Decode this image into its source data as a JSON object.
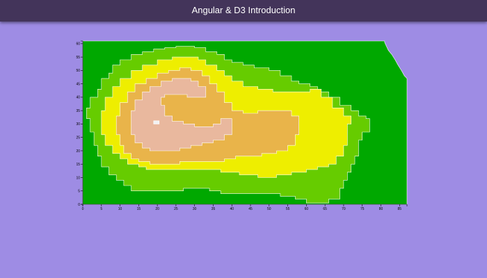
{
  "app": {
    "title": "Angular & D3 Introduction"
  },
  "colors": {
    "page_bg": "#9e8ce4",
    "header_bg": "#43345a",
    "level_colors": [
      "#00a800",
      "#66cc00",
      "#eeee00",
      "#e9b44a",
      "#e9b89e",
      "#f2f2f2"
    ],
    "contour_stroke": "#ffffff"
  },
  "chart_data": {
    "type": "heatmap",
    "title": "",
    "xlabel": "",
    "ylabel": "",
    "xlim": [
      0,
      87
    ],
    "ylim": [
      0,
      61
    ],
    "x_ticks": [
      0,
      5,
      10,
      15,
      20,
      25,
      30,
      35,
      40,
      45,
      50,
      55,
      60,
      65,
      70,
      75,
      80,
      85
    ],
    "y_ticks": [
      0,
      5,
      10,
      15,
      20,
      25,
      30,
      35,
      40,
      45,
      50,
      55,
      60
    ],
    "contour_levels": [
      {
        "level": 1,
        "color": "#66cc00",
        "polygon": [
          [
            2,
            40
          ],
          [
            4,
            43
          ],
          [
            5,
            47
          ],
          [
            7,
            49
          ],
          [
            8,
            52
          ],
          [
            10,
            54
          ],
          [
            13,
            56
          ],
          [
            16,
            57
          ],
          [
            19,
            58
          ],
          [
            22,
            58.5
          ],
          [
            25,
            59
          ],
          [
            28,
            59
          ],
          [
            30,
            58.5
          ],
          [
            33,
            57
          ],
          [
            36,
            56
          ],
          [
            38,
            54
          ],
          [
            40,
            53
          ],
          [
            43,
            52
          ],
          [
            46,
            51
          ],
          [
            50,
            50
          ],
          [
            53,
            48
          ],
          [
            56,
            46
          ],
          [
            58,
            45
          ],
          [
            61,
            44
          ],
          [
            63,
            42
          ],
          [
            66,
            40
          ],
          [
            69,
            37
          ],
          [
            72,
            35
          ],
          [
            74,
            33
          ],
          [
            76,
            32
          ],
          [
            77,
            30
          ],
          [
            77,
            27
          ],
          [
            75,
            24
          ],
          [
            74,
            21
          ],
          [
            74,
            18
          ],
          [
            73,
            15
          ],
          [
            72,
            12
          ],
          [
            71,
            9
          ],
          [
            70,
            6
          ],
          [
            69,
            2
          ],
          [
            66,
            0.5
          ],
          [
            63,
            0.5
          ],
          [
            60,
            2
          ],
          [
            57,
            3
          ],
          [
            53,
            4
          ],
          [
            48,
            4
          ],
          [
            45,
            4
          ],
          [
            40,
            4
          ],
          [
            37,
            5
          ],
          [
            34,
            6
          ],
          [
            30,
            6
          ],
          [
            27,
            5
          ],
          [
            24,
            5
          ],
          [
            21,
            5
          ],
          [
            18,
            5
          ],
          [
            15,
            5
          ],
          [
            13,
            7
          ],
          [
            11,
            9
          ],
          [
            9,
            11
          ],
          [
            7,
            14
          ],
          [
            5,
            18
          ],
          [
            4,
            22
          ],
          [
            3,
            27
          ],
          [
            2,
            32
          ],
          [
            1,
            36
          ]
        ]
      },
      {
        "level": 2,
        "color": "#eeee00",
        "polygon": [
          [
            5,
            35
          ],
          [
            6,
            40
          ],
          [
            8,
            44
          ],
          [
            10,
            47
          ],
          [
            13,
            50
          ],
          [
            16,
            52
          ],
          [
            20,
            54
          ],
          [
            24,
            55
          ],
          [
            28,
            55
          ],
          [
            31,
            54
          ],
          [
            33,
            52
          ],
          [
            36,
            50
          ],
          [
            38,
            48
          ],
          [
            40,
            46
          ],
          [
            43,
            44
          ],
          [
            47,
            43
          ],
          [
            51,
            42
          ],
          [
            56,
            42
          ],
          [
            61,
            43
          ],
          [
            64,
            40
          ],
          [
            67,
            36
          ],
          [
            70,
            33
          ],
          [
            72,
            30
          ],
          [
            71,
            26
          ],
          [
            71,
            22
          ],
          [
            70,
            18
          ],
          [
            68,
            15
          ],
          [
            66,
            14
          ],
          [
            63,
            13
          ],
          [
            60,
            12
          ],
          [
            56,
            11
          ],
          [
            52,
            10
          ],
          [
            47,
            11
          ],
          [
            42,
            12
          ],
          [
            37,
            13
          ],
          [
            32,
            13
          ],
          [
            28,
            13
          ],
          [
            24,
            13
          ],
          [
            20,
            13
          ],
          [
            17,
            14
          ],
          [
            15,
            15
          ],
          [
            12,
            17
          ],
          [
            10,
            19
          ],
          [
            8,
            22
          ],
          [
            6,
            26
          ],
          [
            5,
            30
          ]
        ]
      },
      {
        "level": 3,
        "color": "#e9b44a",
        "polygon": [
          [
            9,
            33
          ],
          [
            10,
            38
          ],
          [
            12,
            42
          ],
          [
            14,
            45
          ],
          [
            17,
            47
          ],
          [
            20,
            49
          ],
          [
            23,
            50
          ],
          [
            26,
            51
          ],
          [
            29,
            50
          ],
          [
            32,
            48
          ],
          [
            34,
            45
          ],
          [
            36,
            42
          ],
          [
            38,
            38
          ],
          [
            40,
            35
          ],
          [
            43,
            34
          ],
          [
            47,
            35
          ],
          [
            50,
            35
          ],
          [
            53,
            35
          ],
          [
            56,
            33
          ],
          [
            58,
            30
          ],
          [
            58,
            26
          ],
          [
            57,
            22
          ],
          [
            55,
            20
          ],
          [
            52,
            19
          ],
          [
            48,
            18
          ],
          [
            45,
            18
          ],
          [
            41,
            17
          ],
          [
            38,
            16
          ],
          [
            34,
            16
          ],
          [
            30,
            16
          ],
          [
            26,
            15
          ],
          [
            22,
            15
          ],
          [
            18,
            16
          ],
          [
            15,
            17
          ],
          [
            13,
            19
          ],
          [
            11,
            22
          ],
          [
            10,
            26
          ],
          [
            9,
            29
          ]
        ]
      },
      {
        "level": 4,
        "color": "#e9b89e",
        "polygon": [
          [
            13,
            31
          ],
          [
            13,
            35
          ],
          [
            14,
            39
          ],
          [
            16,
            42
          ],
          [
            18,
            44
          ],
          [
            21,
            46
          ],
          [
            24,
            47
          ],
          [
            27,
            47
          ],
          [
            29,
            46
          ],
          [
            31,
            44
          ],
          [
            33,
            42
          ],
          [
            33,
            40
          ],
          [
            31,
            40
          ],
          [
            28,
            41
          ],
          [
            25,
            41
          ],
          [
            22,
            40
          ],
          [
            21,
            37
          ],
          [
            22,
            33
          ],
          [
            24,
            31
          ],
          [
            27,
            30
          ],
          [
            30,
            29
          ],
          [
            33,
            29
          ],
          [
            35,
            30
          ],
          [
            37,
            32
          ],
          [
            39,
            32
          ],
          [
            40,
            30
          ],
          [
            40,
            26
          ],
          [
            38,
            24
          ],
          [
            35,
            23
          ],
          [
            32,
            22
          ],
          [
            29,
            21
          ],
          [
            26,
            20
          ],
          [
            23,
            20
          ],
          [
            20,
            20
          ],
          [
            18,
            21
          ],
          [
            16,
            23
          ],
          [
            14,
            26
          ],
          [
            13,
            28
          ]
        ]
      },
      {
        "level": 5,
        "color": "#f2f2f2",
        "polygon": [
          [
            19,
            30
          ],
          [
            20.5,
            30
          ],
          [
            20.5,
            31.2
          ],
          [
            19,
            31.2
          ]
        ]
      }
    ]
  }
}
